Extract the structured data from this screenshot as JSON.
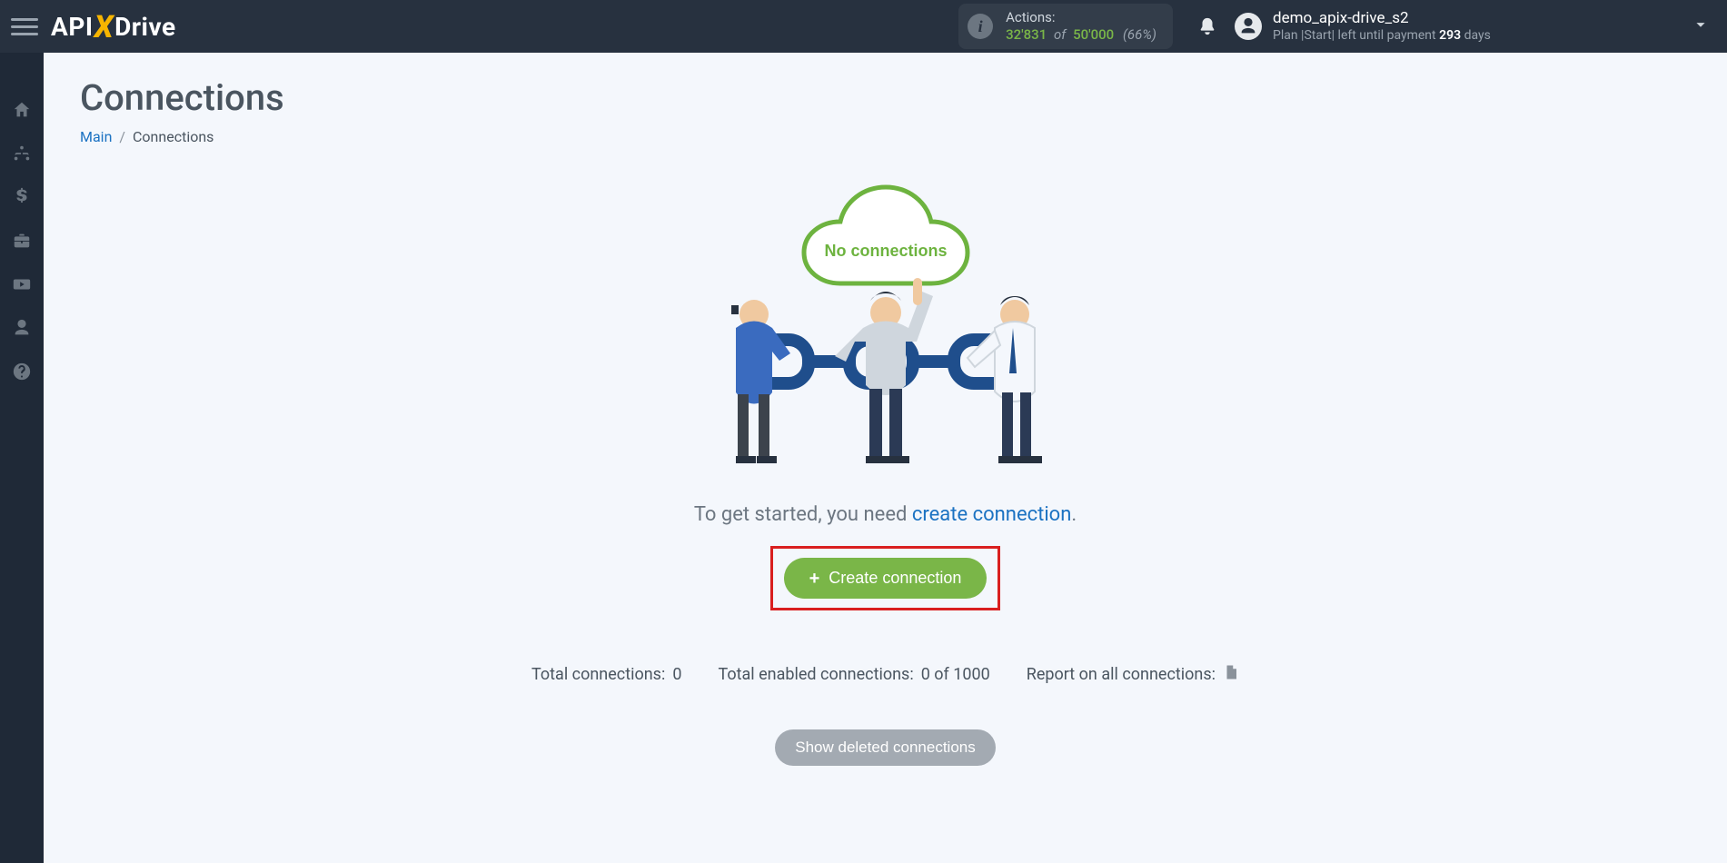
{
  "header": {
    "logo": {
      "pre": "API",
      "x": "X",
      "post": "Drive"
    },
    "actions": {
      "label": "Actions:",
      "used": "32'831",
      "of": "of",
      "total": "50'000",
      "percent": "(66%)"
    },
    "user": {
      "name": "demo_apix-drive_s2",
      "plan_prefix": "Plan |Start| left until payment ",
      "days": "293",
      "plan_suffix": " days"
    }
  },
  "sidebar": {
    "items": [
      {
        "name": "home-icon"
      },
      {
        "name": "connections-icon"
      },
      {
        "name": "billing-icon"
      },
      {
        "name": "toolbox-icon"
      },
      {
        "name": "video-icon"
      },
      {
        "name": "account-icon"
      },
      {
        "name": "help-icon"
      }
    ]
  },
  "page": {
    "title": "Connections",
    "breadcrumb": {
      "main": "Main",
      "sep": "/",
      "current": "Connections"
    },
    "empty_cloud": "No connections",
    "hint_before": "To get started, you need ",
    "hint_link": "create connection",
    "hint_after": ".",
    "create_button": "Create connection",
    "stats": {
      "total_label": "Total connections: ",
      "total_value": "0",
      "enabled_label": "Total enabled connections: ",
      "enabled_value": "0 of 1000",
      "report_label": "Report on all connections: "
    },
    "show_deleted": "Show deleted connections"
  }
}
